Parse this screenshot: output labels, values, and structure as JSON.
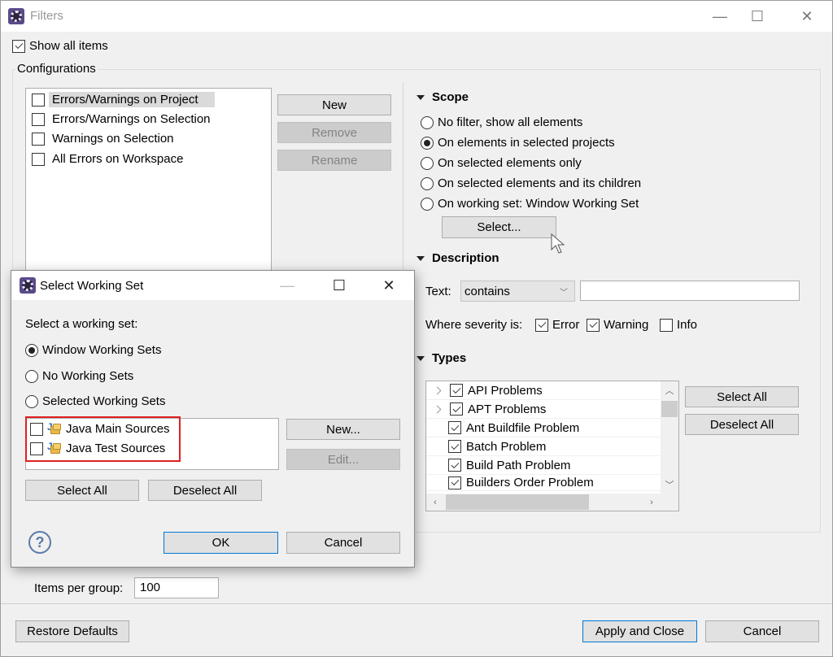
{
  "window": {
    "title": "Filters",
    "controls": {
      "minimize": "—",
      "maximize": "☐",
      "close": "✕"
    }
  },
  "show_all_items": {
    "label": "Show all items",
    "checked": true
  },
  "configurations": {
    "group_label": "Configurations",
    "items": [
      {
        "label": "Errors/Warnings on Project",
        "checked": false,
        "selected": true
      },
      {
        "label": "Errors/Warnings on Selection",
        "checked": false,
        "selected": false
      },
      {
        "label": "Warnings on Selection",
        "checked": false,
        "selected": false
      },
      {
        "label": "All Errors on Workspace",
        "checked": false,
        "selected": false
      }
    ],
    "buttons": {
      "new": "New",
      "remove": "Remove",
      "rename": "Rename"
    }
  },
  "scope": {
    "heading": "Scope",
    "options": [
      {
        "label": "No filter, show all elements",
        "selected": false
      },
      {
        "label": "On elements in selected projects",
        "selected": true
      },
      {
        "label": "On selected elements only",
        "selected": false
      },
      {
        "label": "On selected elements and its children",
        "selected": false
      },
      {
        "label": "On working set:  Window Working Set",
        "selected": false
      }
    ],
    "select_button": "Select..."
  },
  "description": {
    "heading": "Description",
    "text_label": "Text:",
    "text_operator": "contains",
    "text_value": "",
    "severity_label": "Where severity is:",
    "severities": [
      {
        "label": "Error",
        "checked": true
      },
      {
        "label": "Warning",
        "checked": true
      },
      {
        "label": "Info",
        "checked": false
      }
    ]
  },
  "types": {
    "heading": "Types",
    "items": [
      {
        "label": "API Problems",
        "checked": true,
        "expandable": true
      },
      {
        "label": "APT Problems",
        "checked": true,
        "expandable": true
      },
      {
        "label": "Ant Buildfile Problem",
        "checked": true,
        "expandable": false
      },
      {
        "label": "Batch Problem",
        "checked": true,
        "expandable": false
      },
      {
        "label": "Build Path Problem",
        "checked": true,
        "expandable": false
      },
      {
        "label": "Builders Order Problem",
        "checked": true,
        "expandable": false
      }
    ],
    "select_all": "Select All",
    "deselect_all": "Deselect All"
  },
  "items_per_group": {
    "label": "Items per group:",
    "value": "100"
  },
  "footer": {
    "restore_defaults": "Restore Defaults",
    "apply_and_close": "Apply and Close",
    "cancel": "Cancel"
  },
  "dialog": {
    "title": "Select Working Set",
    "controls": {
      "minimize": "—",
      "maximize": "☐",
      "close": "✕"
    },
    "prompt": "Select a working set:",
    "options": [
      {
        "label": "Window Working Sets",
        "selected": true
      },
      {
        "label": "No Working Sets",
        "selected": false
      },
      {
        "label": "Selected Working Sets",
        "selected": false
      }
    ],
    "working_sets": [
      {
        "label": "Java Main Sources",
        "checked": false
      },
      {
        "label": "Java Test Sources",
        "checked": false
      }
    ],
    "highlight_color": "#e02020",
    "buttons": {
      "new": "New...",
      "edit": "Edit...",
      "select_all": "Select All",
      "deselect_all": "Deselect All",
      "ok": "OK",
      "cancel": "Cancel"
    },
    "help_icon": "?"
  }
}
